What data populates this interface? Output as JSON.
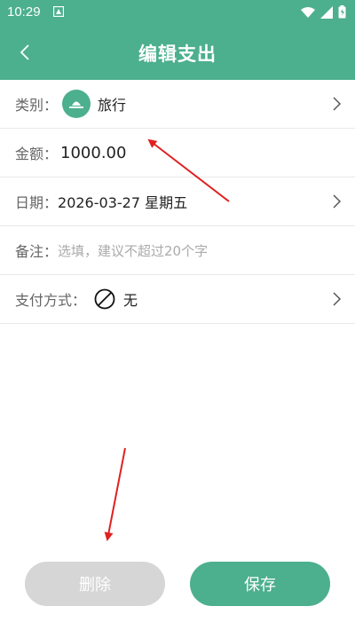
{
  "status_bar": {
    "time": "10:29"
  },
  "header": {
    "back_icon": "chevron-left-icon",
    "title": "编辑支出"
  },
  "form": {
    "category": {
      "label": "类别：",
      "icon": "travel-icon",
      "value": "旅行"
    },
    "amount": {
      "label": "金额：",
      "value": "1000.00"
    },
    "date": {
      "label": "日期：",
      "value": "2026-03-27 星期五"
    },
    "note": {
      "label": "备注：",
      "placeholder": "选填，建议不超过20个字"
    },
    "payment": {
      "label": "支付方式：",
      "icon": "no-entry-icon",
      "value": "无"
    }
  },
  "actions": {
    "delete_label": "删除",
    "save_label": "保存"
  },
  "colors": {
    "accent": "#4caf8e",
    "disabled": "#d6d6d6",
    "annotation": "#e02020"
  }
}
